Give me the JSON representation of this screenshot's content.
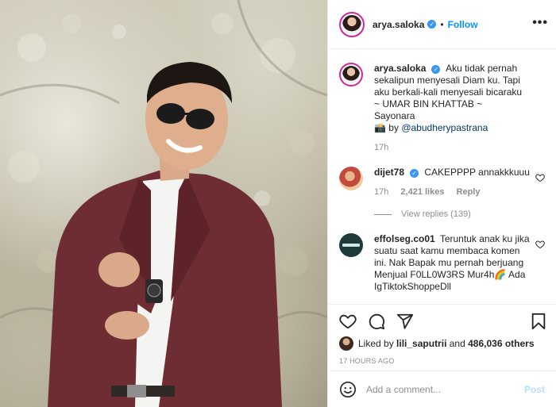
{
  "post": {
    "username": "arya.saloka",
    "follow_label": "Follow",
    "dot": "•",
    "more_label": "•••",
    "verified_mark": "✓"
  },
  "caption": {
    "username": "arya.saloka",
    "line1": "Aku tidak pernah sekalipun menyesali Diam ku. Tapi aku berkali-kali menyesali bicaraku",
    "line2": "~ UMAR BIN KHATTAB ~",
    "line3": "Sayonara",
    "camera_emoji": "📸",
    "by_label": "by",
    "credit": "@abudherypastrana",
    "time": "17h"
  },
  "comments": [
    {
      "username": "dijet78",
      "text": "CAKEPPPP annakkkuuu",
      "time": "17h",
      "likes": "2,421 likes",
      "reply_label": "Reply",
      "view_replies": "View replies (139)"
    },
    {
      "username": "effolseg.co01",
      "text": "Teruntuk anak ku jika suatu saat kamu membaca komen ini. Nak Bapak mu pernah berjuang Menjual F0LL0W3RS Mur4h🌈 Ada IgTiktokShoppeDll"
    }
  ],
  "likes_bar": {
    "prefix": "Liked by",
    "liker": "lili_saputrii",
    "and_label": "and",
    "others": "486,036 others"
  },
  "timestamp": "17 HOURS AGO",
  "add_comment": {
    "placeholder": "Add a comment...",
    "post_label": "Post"
  },
  "icons": [
    "heart-icon",
    "comment-icon",
    "share-icon",
    "bookmark-icon",
    "emoji-icon",
    "more-icon",
    "verified-icon"
  ],
  "colors": {
    "accent": "#0095f6",
    "post_disabled": "#b2dffc",
    "verified": "#3897f0",
    "muted": "#8e8e8e",
    "text": "#262626",
    "blazer": "#6e2c33"
  }
}
